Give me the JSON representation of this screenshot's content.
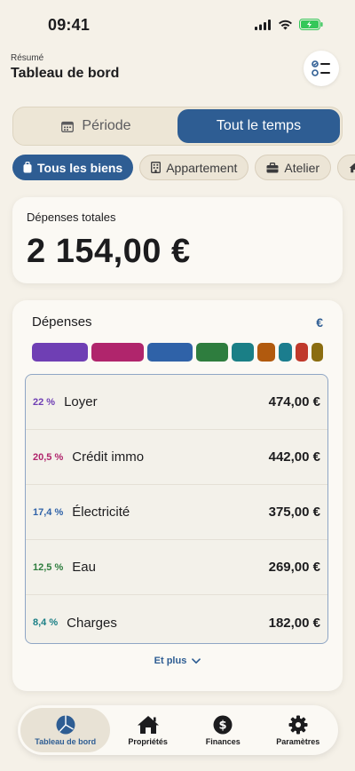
{
  "status_bar": {
    "time": "09:41"
  },
  "header": {
    "subtitle": "Résumé",
    "title": "Tableau de bord"
  },
  "period_toggle": {
    "options": [
      "Période",
      "Tout le temps"
    ],
    "selected": "Tout le temps"
  },
  "filters": {
    "chips": [
      {
        "label": "Tous les biens",
        "icon": "suitcase-icon",
        "active": true
      },
      {
        "label": "Appartement",
        "icon": "building-icon",
        "active": false
      },
      {
        "label": "Atelier",
        "icon": "briefcase-icon",
        "active": false
      },
      {
        "label": "",
        "icon": "house-icon",
        "active": false
      }
    ]
  },
  "total": {
    "label": "Dépenses totales",
    "value": "2 154,00 €"
  },
  "expenses": {
    "title": "Dépenses",
    "currency": "€",
    "bar_colors": [
      "#6f3fb4",
      "#b0256c",
      "#2f62a8",
      "#2e7d3e",
      "#1a7f86",
      "#b15a0e",
      "#1b7d8e",
      "#c0392b",
      "#8b6d10"
    ],
    "items": [
      {
        "pct": "22 %",
        "name": "Loyer",
        "amount": "474,00 €",
        "color": "#6f3fb4"
      },
      {
        "pct": "20,5 %",
        "name": "Crédit immo",
        "amount": "442,00 €",
        "color": "#b0256c"
      },
      {
        "pct": "17,4 %",
        "name": "Électricité",
        "amount": "375,00 €",
        "color": "#2f62a8"
      },
      {
        "pct": "12,5 %",
        "name": "Eau",
        "amount": "269,00 €",
        "color": "#2e7d3e"
      },
      {
        "pct": "8,4 %",
        "name": "Charges",
        "amount": "182,00 €",
        "color": "#1a7f86"
      }
    ],
    "more_label": "Et plus"
  },
  "tabbar": {
    "tabs": [
      {
        "label": "Tableau de bord",
        "icon": "pie-chart-icon",
        "active": true
      },
      {
        "label": "Propriétés",
        "icon": "house-icon",
        "active": false
      },
      {
        "label": "Finances",
        "icon": "dollar-icon",
        "active": false
      },
      {
        "label": "Paramètres",
        "icon": "gear-icon",
        "active": false
      }
    ]
  }
}
